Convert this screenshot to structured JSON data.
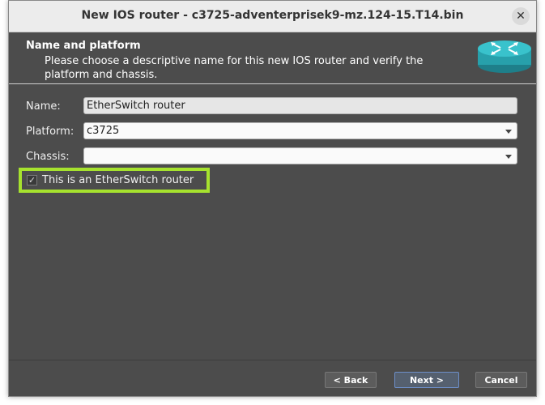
{
  "window": {
    "title": "New IOS router - c3725-adventerprisek9-mz.124-15.T14.bin"
  },
  "header": {
    "title": "Name and platform",
    "subtitle": "Please choose a descriptive name for this new IOS router and verify the platform and chassis."
  },
  "form": {
    "name_label": "Name:",
    "name_value": "EtherSwitch router",
    "platform_label": "Platform:",
    "platform_value": "c3725",
    "chassis_label": "Chassis:",
    "chassis_value": "",
    "etherswitch_label": "This is an EtherSwitch router",
    "etherswitch_checked": true
  },
  "buttons": {
    "back": "< Back",
    "next": "Next >",
    "cancel": "Cancel"
  },
  "colors": {
    "highlight": "#a6e22e",
    "panel": "#4c4c4c"
  },
  "icons": [
    "close-icon",
    "router-icon",
    "dropdown-caret-icon",
    "check-icon"
  ]
}
